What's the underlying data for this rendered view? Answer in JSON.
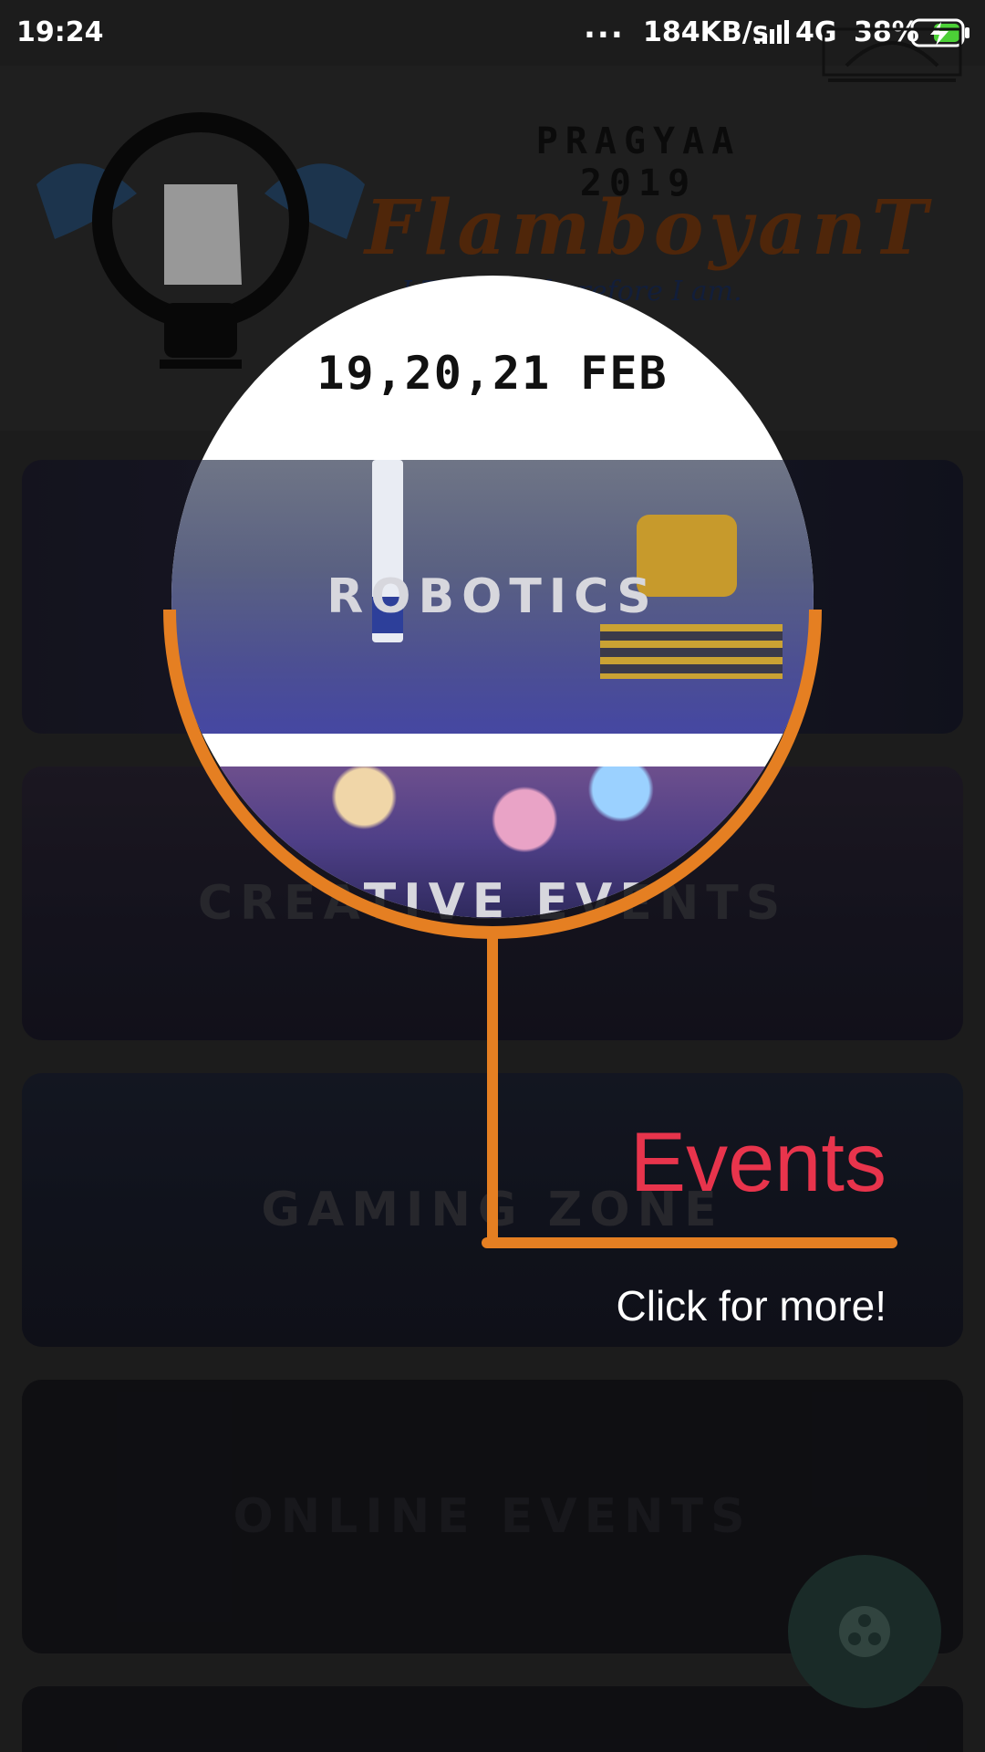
{
  "status_bar": {
    "time": "19:24",
    "dots": "...",
    "speed": "184KB/s",
    "network": "4G",
    "battery": "38%"
  },
  "header": {
    "title_line1": "PRAGYAA",
    "title_line2": "2019",
    "name": "FlamboyanT",
    "tagline": "I Think . Therefore I am."
  },
  "spotlight": {
    "date": "19,20,21 FEB"
  },
  "categories": [
    {
      "label": "ROBOTICS"
    },
    {
      "label": "CREATIVE EVENTS"
    },
    {
      "label": "GAMING ZONE"
    },
    {
      "label": "ONLINE EVENTS"
    }
  ],
  "tutorial": {
    "title": "Events",
    "subtitle": "Click for more!"
  },
  "fab": {
    "icon": "share-icon"
  },
  "colors": {
    "accent_orange": "#e57f22",
    "title_red": "#e8344c"
  }
}
